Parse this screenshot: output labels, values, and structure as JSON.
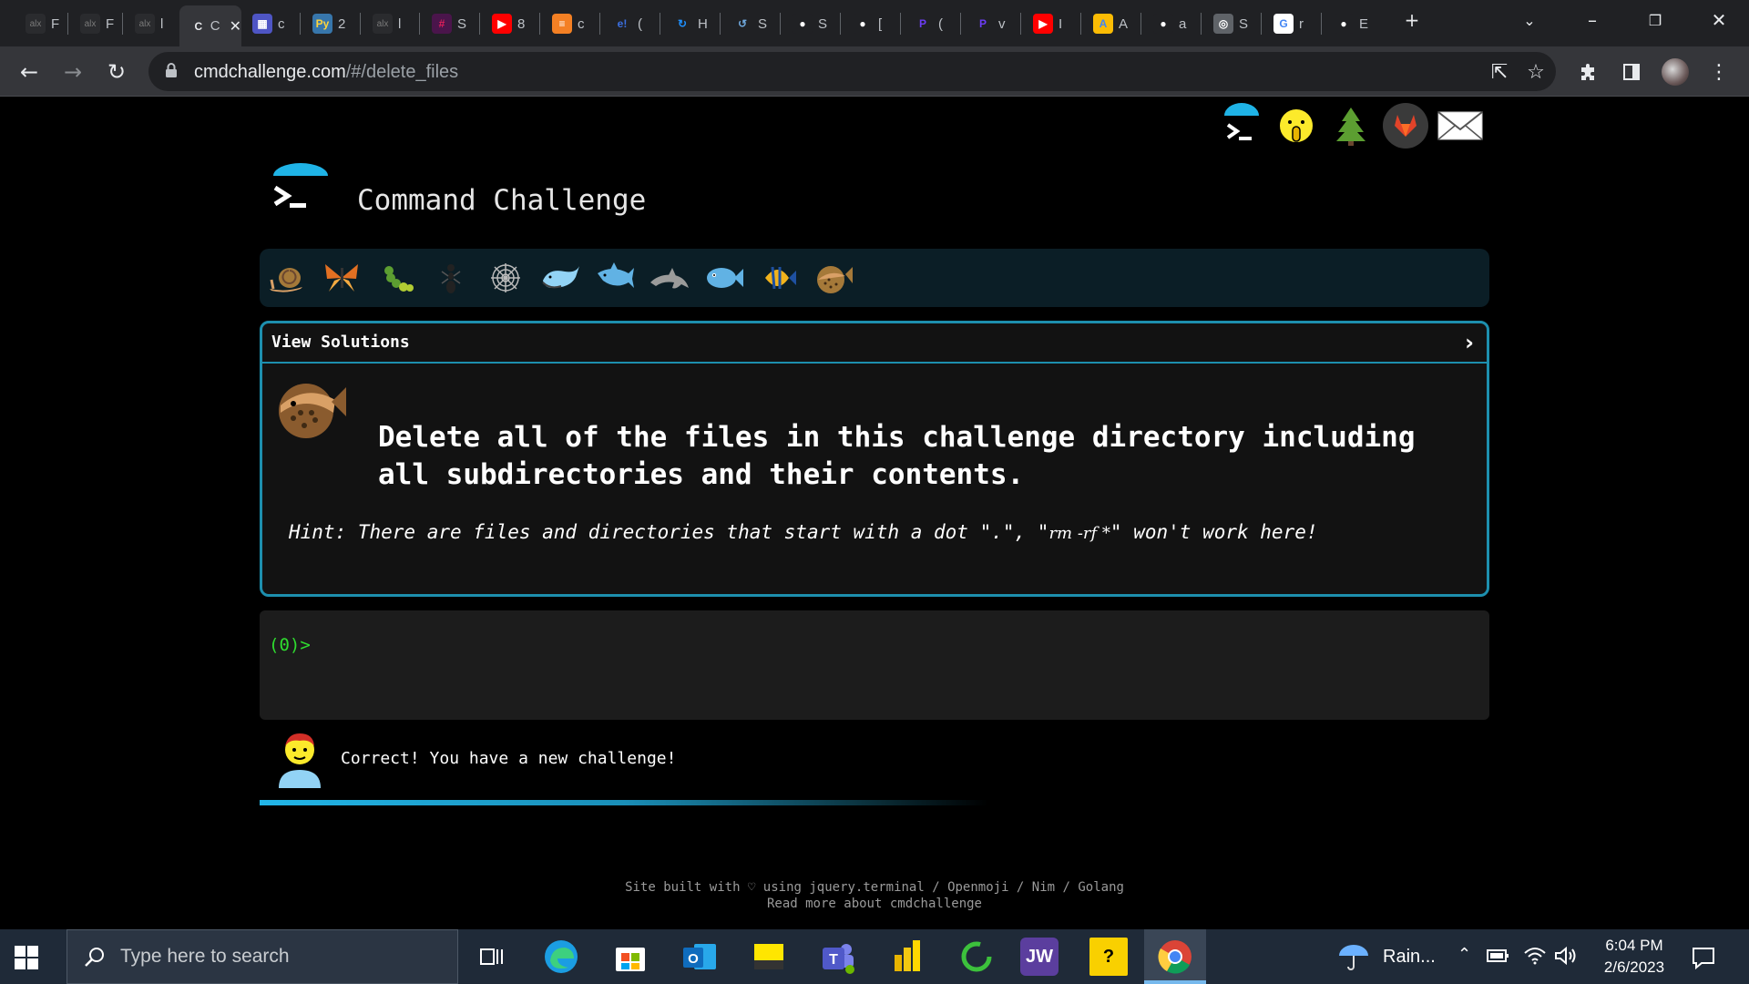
{
  "browser": {
    "tabs": [
      {
        "label": "F",
        "fav": "alx"
      },
      {
        "label": "F",
        "fav": "alx"
      },
      {
        "label": "l",
        "fav": "alx"
      },
      {
        "label": "C",
        "fav": "cmd",
        "active": true
      },
      {
        "label": "c",
        "fav": "grid"
      },
      {
        "label": "2",
        "fav": "python"
      },
      {
        "label": "l",
        "fav": "alx"
      },
      {
        "label": "S",
        "fav": "slack"
      },
      {
        "label": "8",
        "fav": "youtube"
      },
      {
        "label": "c",
        "fav": "stackoverflow"
      },
      {
        "label": "(",
        "fav": "e!"
      },
      {
        "label": "H",
        "fav": "sync"
      },
      {
        "label": "S",
        "fav": "sync2"
      },
      {
        "label": "S",
        "fav": "github"
      },
      {
        "label": "[",
        "fav": "github"
      },
      {
        "label": "(",
        "fav": "p"
      },
      {
        "label": "v",
        "fav": "p"
      },
      {
        "label": "I",
        "fav": "youtube"
      },
      {
        "label": "A",
        "fav": "ads"
      },
      {
        "label": "a",
        "fav": "github"
      },
      {
        "label": "S",
        "fav": "globe"
      },
      {
        "label": "r",
        "fav": "google"
      },
      {
        "label": "E",
        "fav": "github"
      }
    ],
    "url_domain": "cmdchallenge.com",
    "url_path": "/#/delete_files"
  },
  "page": {
    "title": "Command Challenge",
    "view_solutions": "View Solutions",
    "challenge_text": "Delete all of the files in this challenge directory including all subdirectories and their contents.",
    "hint_prefix": "Hint: There are files and directories that start with a dot \".\", \"",
    "hint_code": "rm -rf *",
    "hint_suffix": "\" won't work here!",
    "prompt": "(0)>",
    "result_message": "Correct! You have a new challenge!",
    "footer_line1": "Site built with ♡ using jquery.terminal / Openmoji / Nim / Golang",
    "footer_line2": "Read more about cmdchallenge",
    "level_icons": [
      "snail-icon",
      "butterfly-icon",
      "caterpillar-icon",
      "ant-icon",
      "spider-web-icon",
      "whale-icon",
      "shark-icon",
      "dolphin-icon",
      "fish-icon",
      "tropical-fish-icon",
      "blowfish-icon"
    ],
    "top_icons": [
      "terminal-logo-icon",
      "shushing-face-icon",
      "tree-icon",
      "gitlab-icon",
      "envelope-icon"
    ]
  },
  "taskbar": {
    "search_placeholder": "Type here to search",
    "weather": "Rain...",
    "time": "6:04 PM",
    "date": "2/6/2023",
    "apps": [
      "task-view-icon",
      "edge-icon",
      "store-icon",
      "outlook-icon",
      "discover-icon",
      "teams-icon",
      "powerbi-icon",
      "loading-ring-icon",
      "jw-icon",
      "help-icon",
      "chrome-icon"
    ],
    "jw_label": "JW",
    "help_label": "?"
  }
}
